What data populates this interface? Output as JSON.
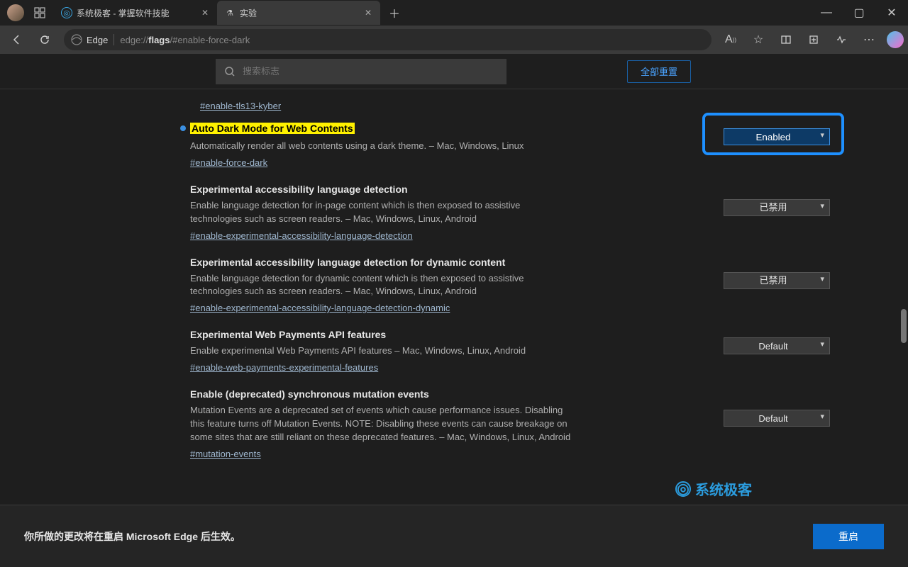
{
  "tabs": [
    {
      "title": "系统极客 - 掌握软件技能"
    },
    {
      "title": "实验"
    }
  ],
  "address": {
    "brand": "Edge",
    "url_prefix": "edge://",
    "url_bold": "flags",
    "url_suffix": "/#enable-force-dark"
  },
  "search": {
    "placeholder": "搜索标志"
  },
  "reset_all": "全部重置",
  "top_hash": "#enable-tls13-kyber",
  "flags": [
    {
      "title": "Auto Dark Mode for Web Contents",
      "desc": "Automatically render all web contents using a dark theme. – Mac, Windows, Linux",
      "hash": "#enable-force-dark",
      "value": "Enabled",
      "highlighted": true,
      "modified": true
    },
    {
      "title": "Experimental accessibility language detection",
      "desc": "Enable language detection for in-page content which is then exposed to assistive technologies such as screen readers. – Mac, Windows, Linux, Android",
      "hash": "#enable-experimental-accessibility-language-detection",
      "value": "已禁用"
    },
    {
      "title": "Experimental accessibility language detection for dynamic content",
      "desc": "Enable language detection for dynamic content which is then exposed to assistive technologies such as screen readers. – Mac, Windows, Linux, Android",
      "hash": "#enable-experimental-accessibility-language-detection-dynamic",
      "value": "已禁用"
    },
    {
      "title": "Experimental Web Payments API features",
      "desc": "Enable experimental Web Payments API features – Mac, Windows, Linux, Android",
      "hash": "#enable-web-payments-experimental-features",
      "value": "Default"
    },
    {
      "title": "Enable (deprecated) synchronous mutation events",
      "desc": "Mutation Events are a deprecated set of events which cause performance issues. Disabling this feature turns off Mutation Events. NOTE: Disabling these events can cause breakage on some sites that are still reliant on these deprecated features. – Mac, Windows, Linux, Android",
      "hash": "#mutation-events",
      "value": "Default"
    }
  ],
  "footer": {
    "message": "你所做的更改将在重启 Microsoft Edge 后生效。",
    "restart": "重启"
  },
  "watermark": "系统极客"
}
